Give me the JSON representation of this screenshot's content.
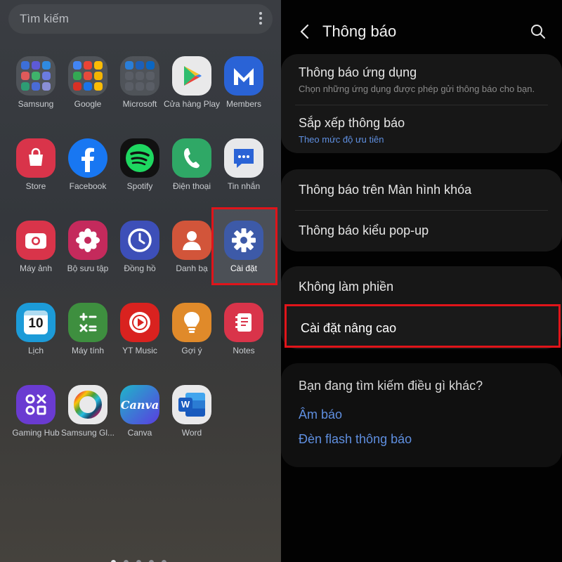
{
  "drawer": {
    "search_placeholder": "Tìm kiếm",
    "apps": [
      {
        "label": "Samsung",
        "icon": "samsung-folder-icon",
        "type": "folder"
      },
      {
        "label": "Google",
        "icon": "google-folder-icon",
        "type": "folder"
      },
      {
        "label": "Microsoft",
        "icon": "microsoft-folder-icon",
        "type": "folder"
      },
      {
        "label": "Cửa hàng Play",
        "icon": "play-store-icon"
      },
      {
        "label": "Members",
        "icon": "members-icon"
      },
      {
        "label": "Store",
        "icon": "store-icon"
      },
      {
        "label": "Facebook",
        "icon": "facebook-icon"
      },
      {
        "label": "Spotify",
        "icon": "spotify-icon"
      },
      {
        "label": "Điện thoại",
        "icon": "phone-icon"
      },
      {
        "label": "Tin nhắn",
        "icon": "messages-icon"
      },
      {
        "label": "Máy ảnh",
        "icon": "camera-icon"
      },
      {
        "label": "Bộ sưu tập",
        "icon": "gallery-icon"
      },
      {
        "label": "Đồng hồ",
        "icon": "clock-icon"
      },
      {
        "label": "Danh bạ",
        "icon": "contacts-icon"
      },
      {
        "label": "Cài đặt",
        "icon": "settings-gear-icon"
      },
      {
        "label": "Lịch",
        "icon": "calendar-icon",
        "glyph": "10"
      },
      {
        "label": "Máy tính",
        "icon": "calculator-icon"
      },
      {
        "label": "YT Music",
        "icon": "yt-music-icon"
      },
      {
        "label": "Gợi ý",
        "icon": "tips-lightbulb-icon"
      },
      {
        "label": "Notes",
        "icon": "notes-icon"
      },
      {
        "label": "Gaming Hub",
        "icon": "gaming-hub-icon"
      },
      {
        "label": "Samsung Gl...",
        "icon": "samsung-global-goals-icon"
      },
      {
        "label": "Canva",
        "icon": "canva-icon",
        "glyph": "Canva"
      },
      {
        "label": "Word",
        "icon": "word-icon",
        "glyph": "W"
      }
    ],
    "page_count": 5,
    "active_page": 0
  },
  "settings": {
    "title": "Thông báo",
    "group1": {
      "app_notifications_title": "Thông báo ứng dụng",
      "app_notifications_sub": "Chọn những ứng dụng được phép gửi thông báo cho bạn.",
      "sort_title": "Sắp xếp thông báo",
      "sort_sub": "Theo mức độ ưu tiên"
    },
    "group2": {
      "lock_screen": "Thông báo trên Màn hình khóa",
      "popup": "Thông báo kiểu pop-up"
    },
    "group3": {
      "dnd": "Không làm phiền",
      "advanced": "Cài đặt nâng cao"
    },
    "suggestions": {
      "heading": "Bạn đang tìm kiếm điều gì khác?",
      "link1": "Âm báo",
      "link2": "Đèn flash thông báo"
    }
  },
  "colors": {
    "highlight": "#e0141a",
    "link_blue": "#5f8fe0"
  }
}
